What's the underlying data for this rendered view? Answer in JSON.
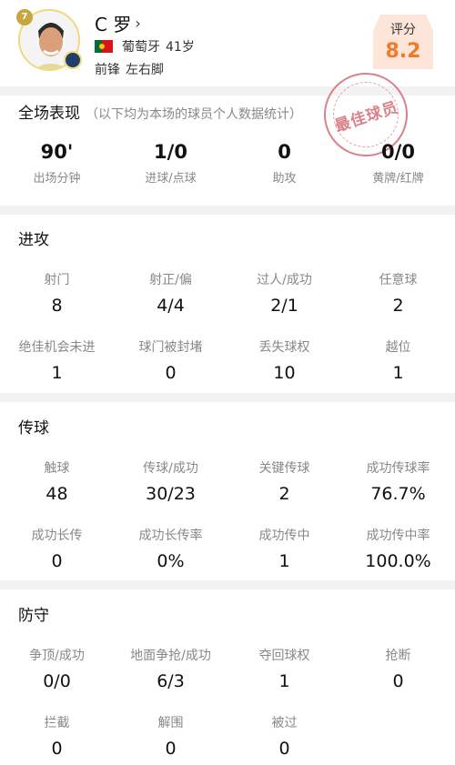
{
  "player": {
    "jersey_number": "7",
    "name": "C 罗",
    "chevron": "›",
    "country": "葡萄牙",
    "age": "41岁",
    "position": "前锋",
    "foot": "左右脚"
  },
  "rating": {
    "label": "评分",
    "value": "8.2"
  },
  "stamp": {
    "text": "最佳球员"
  },
  "overview": {
    "title": "全场表现",
    "subtitle": "（以下均为本场的球员个人数据统计）",
    "stats": [
      {
        "value": "90'",
        "label": "出场分钟"
      },
      {
        "value": "1/0",
        "label": "进球/点球"
      },
      {
        "value": "0",
        "label": "助攻"
      },
      {
        "value": "0/0",
        "label": "黄牌/红牌"
      }
    ]
  },
  "attack": {
    "title": "进攻",
    "stats": [
      {
        "label": "射门",
        "value": "8"
      },
      {
        "label": "射正/偏",
        "value": "4/4"
      },
      {
        "label": "过人/成功",
        "value": "2/1"
      },
      {
        "label": "任意球",
        "value": "2"
      },
      {
        "label": "绝佳机会未进",
        "value": "1"
      },
      {
        "label": "球门被封堵",
        "value": "0"
      },
      {
        "label": "丢失球权",
        "value": "10"
      },
      {
        "label": "越位",
        "value": "1"
      }
    ]
  },
  "passing": {
    "title": "传球",
    "stats": [
      {
        "label": "触球",
        "value": "48"
      },
      {
        "label": "传球/成功",
        "value": "30/23"
      },
      {
        "label": "关键传球",
        "value": "2"
      },
      {
        "label": "成功传球率",
        "value": "76.7%"
      },
      {
        "label": "成功长传",
        "value": "0"
      },
      {
        "label": "成功长传率",
        "value": "0%"
      },
      {
        "label": "成功传中",
        "value": "1"
      },
      {
        "label": "成功传中率",
        "value": "100.0%"
      }
    ]
  },
  "defense": {
    "title": "防守",
    "stats": [
      {
        "label": "争顶/成功",
        "value": "0/0"
      },
      {
        "label": "地面争抢/成功",
        "value": "6/3"
      },
      {
        "label": "夺回球权",
        "value": "1"
      },
      {
        "label": "抢断",
        "value": "0"
      },
      {
        "label": "拦截",
        "value": "0"
      },
      {
        "label": "解围",
        "value": "0"
      },
      {
        "label": "被过",
        "value": "0"
      }
    ]
  },
  "colors": {
    "accent": "#f07a2a",
    "rating_bg": "#fde6d9",
    "stamp": "#d9828a",
    "divider": "#f2f2f2"
  }
}
